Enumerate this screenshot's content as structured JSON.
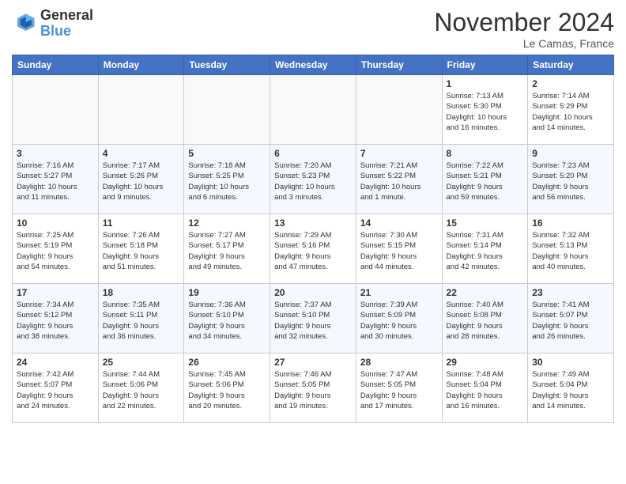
{
  "header": {
    "logo_line1": "General",
    "logo_line2": "Blue",
    "month": "November 2024",
    "location": "Le Camas, France"
  },
  "weekdays": [
    "Sunday",
    "Monday",
    "Tuesday",
    "Wednesday",
    "Thursday",
    "Friday",
    "Saturday"
  ],
  "weeks": [
    [
      {
        "day": "",
        "info": ""
      },
      {
        "day": "",
        "info": ""
      },
      {
        "day": "",
        "info": ""
      },
      {
        "day": "",
        "info": ""
      },
      {
        "day": "",
        "info": ""
      },
      {
        "day": "1",
        "info": "Sunrise: 7:13 AM\nSunset: 5:30 PM\nDaylight: 10 hours\nand 16 minutes."
      },
      {
        "day": "2",
        "info": "Sunrise: 7:14 AM\nSunset: 5:29 PM\nDaylight: 10 hours\nand 14 minutes."
      }
    ],
    [
      {
        "day": "3",
        "info": "Sunrise: 7:16 AM\nSunset: 5:27 PM\nDaylight: 10 hours\nand 11 minutes."
      },
      {
        "day": "4",
        "info": "Sunrise: 7:17 AM\nSunset: 5:26 PM\nDaylight: 10 hours\nand 9 minutes."
      },
      {
        "day": "5",
        "info": "Sunrise: 7:18 AM\nSunset: 5:25 PM\nDaylight: 10 hours\nand 6 minutes."
      },
      {
        "day": "6",
        "info": "Sunrise: 7:20 AM\nSunset: 5:23 PM\nDaylight: 10 hours\nand 3 minutes."
      },
      {
        "day": "7",
        "info": "Sunrise: 7:21 AM\nSunset: 5:22 PM\nDaylight: 10 hours\nand 1 minute."
      },
      {
        "day": "8",
        "info": "Sunrise: 7:22 AM\nSunset: 5:21 PM\nDaylight: 9 hours\nand 59 minutes."
      },
      {
        "day": "9",
        "info": "Sunrise: 7:23 AM\nSunset: 5:20 PM\nDaylight: 9 hours\nand 56 minutes."
      }
    ],
    [
      {
        "day": "10",
        "info": "Sunrise: 7:25 AM\nSunset: 5:19 PM\nDaylight: 9 hours\nand 54 minutes."
      },
      {
        "day": "11",
        "info": "Sunrise: 7:26 AM\nSunset: 5:18 PM\nDaylight: 9 hours\nand 51 minutes."
      },
      {
        "day": "12",
        "info": "Sunrise: 7:27 AM\nSunset: 5:17 PM\nDaylight: 9 hours\nand 49 minutes."
      },
      {
        "day": "13",
        "info": "Sunrise: 7:29 AM\nSunset: 5:16 PM\nDaylight: 9 hours\nand 47 minutes."
      },
      {
        "day": "14",
        "info": "Sunrise: 7:30 AM\nSunset: 5:15 PM\nDaylight: 9 hours\nand 44 minutes."
      },
      {
        "day": "15",
        "info": "Sunrise: 7:31 AM\nSunset: 5:14 PM\nDaylight: 9 hours\nand 42 minutes."
      },
      {
        "day": "16",
        "info": "Sunrise: 7:32 AM\nSunset: 5:13 PM\nDaylight: 9 hours\nand 40 minutes."
      }
    ],
    [
      {
        "day": "17",
        "info": "Sunrise: 7:34 AM\nSunset: 5:12 PM\nDaylight: 9 hours\nand 38 minutes."
      },
      {
        "day": "18",
        "info": "Sunrise: 7:35 AM\nSunset: 5:11 PM\nDaylight: 9 hours\nand 36 minutes."
      },
      {
        "day": "19",
        "info": "Sunrise: 7:36 AM\nSunset: 5:10 PM\nDaylight: 9 hours\nand 34 minutes."
      },
      {
        "day": "20",
        "info": "Sunrise: 7:37 AM\nSunset: 5:10 PM\nDaylight: 9 hours\nand 32 minutes."
      },
      {
        "day": "21",
        "info": "Sunrise: 7:39 AM\nSunset: 5:09 PM\nDaylight: 9 hours\nand 30 minutes."
      },
      {
        "day": "22",
        "info": "Sunrise: 7:40 AM\nSunset: 5:08 PM\nDaylight: 9 hours\nand 28 minutes."
      },
      {
        "day": "23",
        "info": "Sunrise: 7:41 AM\nSunset: 5:07 PM\nDaylight: 9 hours\nand 26 minutes."
      }
    ],
    [
      {
        "day": "24",
        "info": "Sunrise: 7:42 AM\nSunset: 5:07 PM\nDaylight: 9 hours\nand 24 minutes."
      },
      {
        "day": "25",
        "info": "Sunrise: 7:44 AM\nSunset: 5:06 PM\nDaylight: 9 hours\nand 22 minutes."
      },
      {
        "day": "26",
        "info": "Sunrise: 7:45 AM\nSunset: 5:06 PM\nDaylight: 9 hours\nand 20 minutes."
      },
      {
        "day": "27",
        "info": "Sunrise: 7:46 AM\nSunset: 5:05 PM\nDaylight: 9 hours\nand 19 minutes."
      },
      {
        "day": "28",
        "info": "Sunrise: 7:47 AM\nSunset: 5:05 PM\nDaylight: 9 hours\nand 17 minutes."
      },
      {
        "day": "29",
        "info": "Sunrise: 7:48 AM\nSunset: 5:04 PM\nDaylight: 9 hours\nand 16 minutes."
      },
      {
        "day": "30",
        "info": "Sunrise: 7:49 AM\nSunset: 5:04 PM\nDaylight: 9 hours\nand 14 minutes."
      }
    ]
  ]
}
